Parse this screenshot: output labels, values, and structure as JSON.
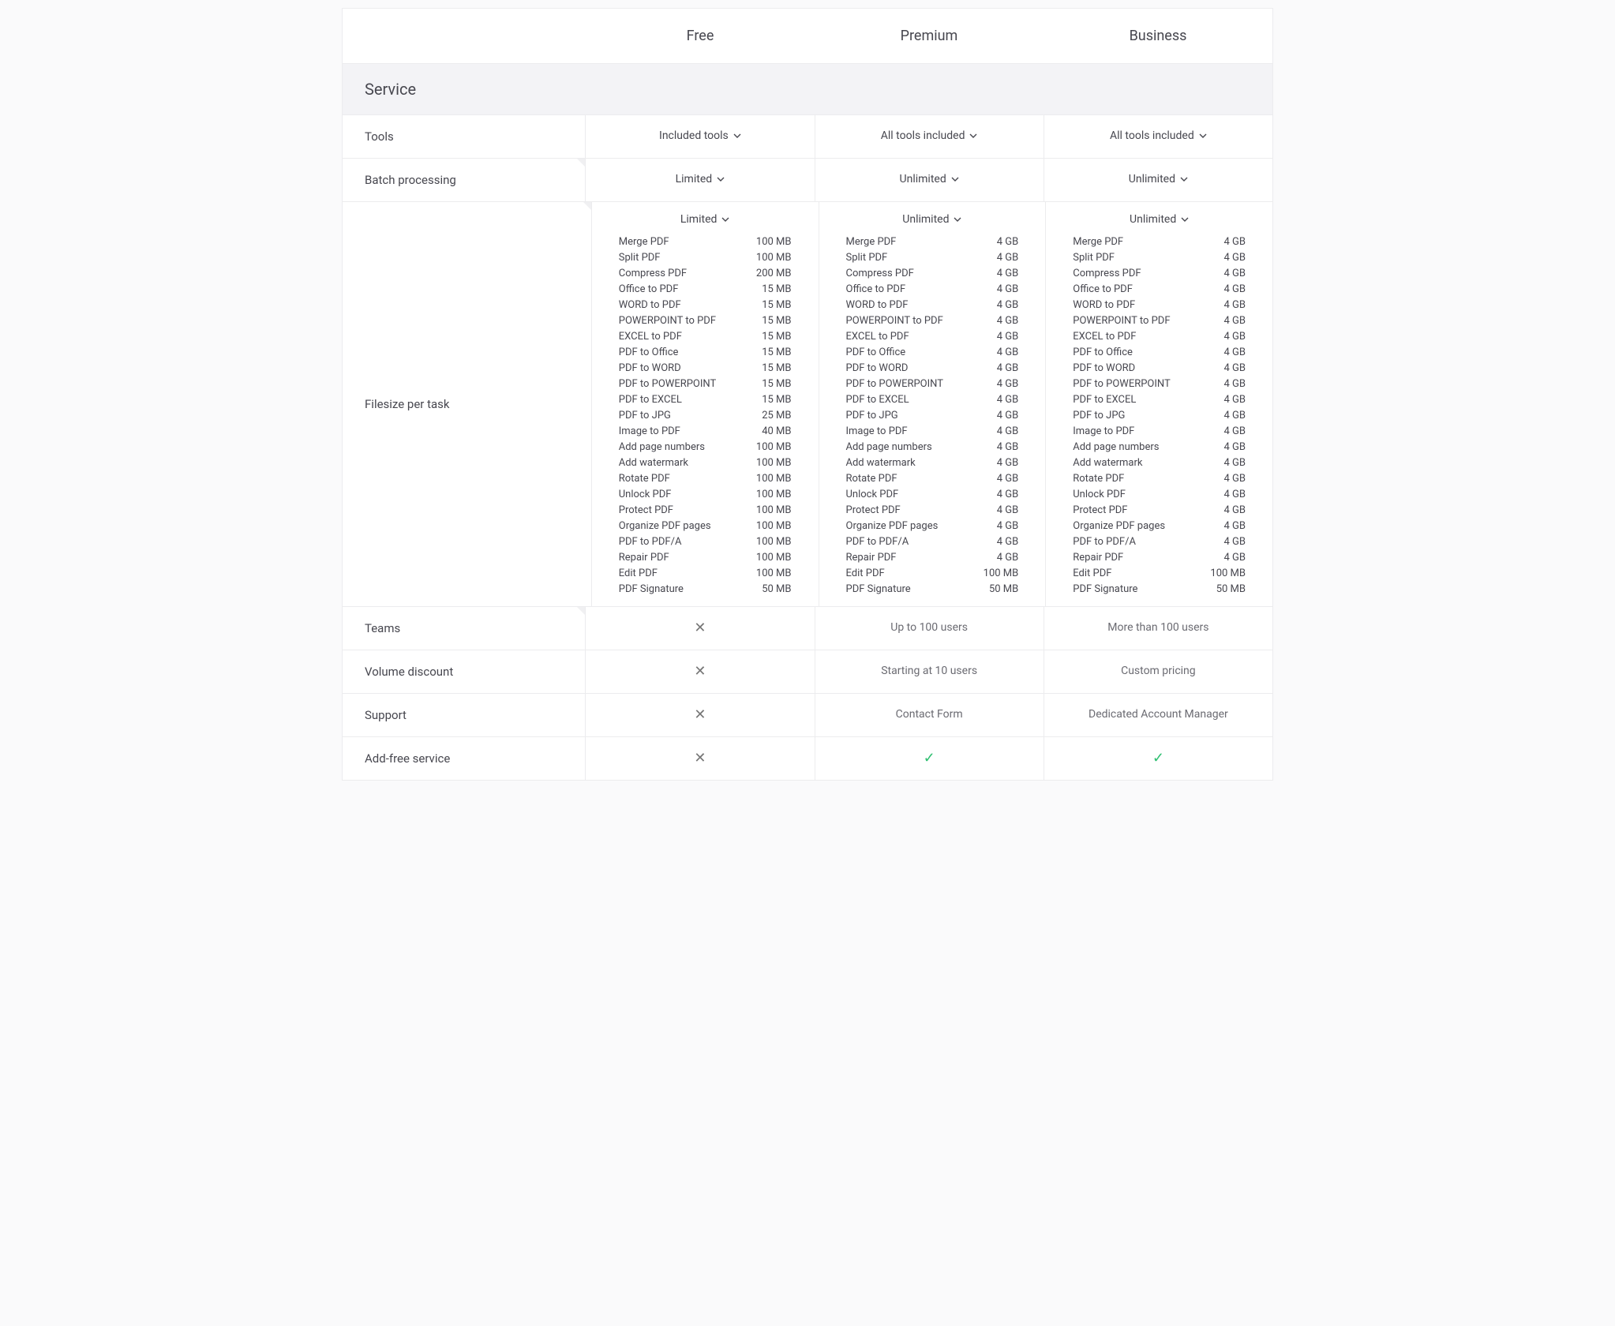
{
  "plans": [
    "Free",
    "Premium",
    "Business"
  ],
  "section_label": "Service",
  "rows": {
    "tools": {
      "label": "Tools",
      "values": [
        "Included tools",
        "All tools included",
        "All tools included"
      ],
      "dropdown": true
    },
    "batch": {
      "label": "Batch processing",
      "values": [
        "Limited",
        "Unlimited",
        "Unlimited"
      ],
      "dropdown": true
    },
    "filesize": {
      "label": "Filesize per task",
      "head_values": [
        "Limited",
        "Unlimited",
        "Unlimited"
      ],
      "dropdown": true,
      "tools": [
        "Merge PDF",
        "Split PDF",
        "Compress PDF",
        "Office to PDF",
        "WORD to PDF",
        "POWERPOINT to PDF",
        "EXCEL to PDF",
        "PDF to Office",
        "PDF to WORD",
        "PDF to POWERPOINT",
        "PDF to EXCEL",
        "PDF to JPG",
        "Image to PDF",
        "Add page numbers",
        "Add watermark",
        "Rotate PDF",
        "Unlock PDF",
        "Protect PDF",
        "Organize PDF pages",
        "PDF to PDF/A",
        "Repair PDF",
        "Edit PDF",
        "PDF Signature"
      ],
      "sizes": {
        "free": [
          "100 MB",
          "100 MB",
          "200 MB",
          "15 MB",
          "15 MB",
          "15 MB",
          "15 MB",
          "15 MB",
          "15 MB",
          "15 MB",
          "15 MB",
          "25 MB",
          "40 MB",
          "100 MB",
          "100 MB",
          "100 MB",
          "100 MB",
          "100 MB",
          "100 MB",
          "100 MB",
          "100 MB",
          "100 MB",
          "50 MB"
        ],
        "premium": [
          "4 GB",
          "4 GB",
          "4 GB",
          "4 GB",
          "4 GB",
          "4 GB",
          "4 GB",
          "4 GB",
          "4 GB",
          "4 GB",
          "4 GB",
          "4 GB",
          "4 GB",
          "4 GB",
          "4 GB",
          "4 GB",
          "4 GB",
          "4 GB",
          "4 GB",
          "4 GB",
          "4 GB",
          "100 MB",
          "50 MB"
        ],
        "business": [
          "4 GB",
          "4 GB",
          "4 GB",
          "4 GB",
          "4 GB",
          "4 GB",
          "4 GB",
          "4 GB",
          "4 GB",
          "4 GB",
          "4 GB",
          "4 GB",
          "4 GB",
          "4 GB",
          "4 GB",
          "4 GB",
          "4 GB",
          "4 GB",
          "4 GB",
          "4 GB",
          "4 GB",
          "100 MB",
          "50 MB"
        ]
      }
    },
    "teams": {
      "label": "Teams",
      "values": [
        "x",
        "Up to 100 users",
        "More than 100 users"
      ]
    },
    "volume": {
      "label": "Volume discount",
      "values": [
        "x",
        "Starting at 10 users",
        "Custom pricing"
      ]
    },
    "support": {
      "label": "Support",
      "values": [
        "x",
        "Contact Form",
        "Dedicated Account Manager"
      ]
    },
    "adfree": {
      "label": "Add-free service",
      "values": [
        "x",
        "check",
        "check"
      ]
    }
  }
}
